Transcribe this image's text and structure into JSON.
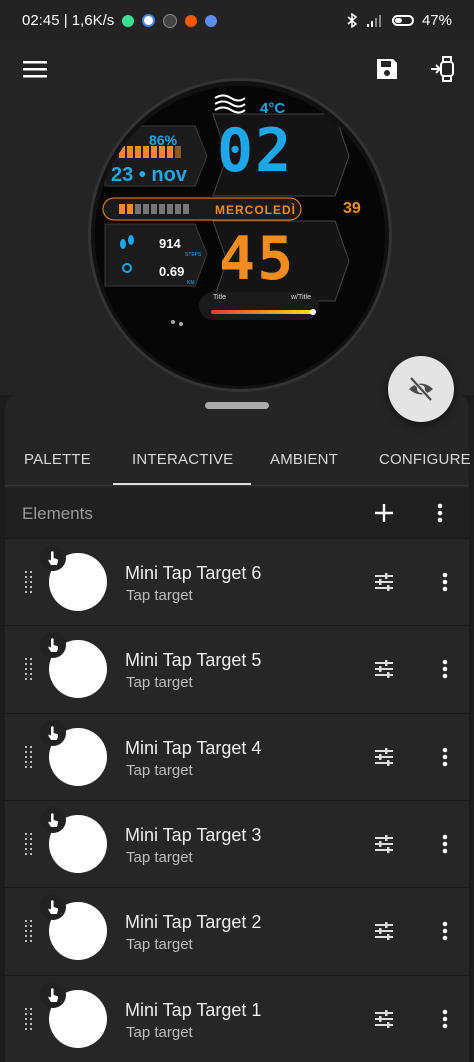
{
  "status_bar": {
    "time_speed": "02:45 | 1,6K/s",
    "battery": "47%",
    "notification_icons": [
      "app-icon",
      "google-icon",
      "app-icon",
      "reddit-icon",
      "app-icon"
    ],
    "system_icons": [
      "bluetooth-icon",
      "wifi-icon",
      "signal-icon",
      "battery-icon"
    ]
  },
  "toolbar": {
    "menu_icon": "hamburger-menu-icon",
    "save_icon": "save-icon",
    "send_to_watch_icon": "watch-sync-icon"
  },
  "watch_face": {
    "weather_icon": "wind-icon",
    "temperature": "4°C",
    "battery_percent": "86%",
    "hours": "02",
    "minutes": "45",
    "date": "23 • nov",
    "weekday": "MERCOLEDÌ",
    "seconds": "39",
    "steps": "914",
    "steps_label": "STEPS",
    "distance": "0.69",
    "distance_label": "KM",
    "bar_title_left": "Title",
    "bar_title_right": "w/Title",
    "colors": {
      "accent_orange": "#f28c1e",
      "accent_blue": "#1ea7e8"
    }
  },
  "visibility_fab_icon": "eye-off-icon",
  "tabs": [
    {
      "label": "PALETTE",
      "active": false
    },
    {
      "label": "INTERACTIVE",
      "active": true
    },
    {
      "label": "AMBIENT",
      "active": false
    },
    {
      "label": "CONFIGURE",
      "active": false
    }
  ],
  "elements": {
    "title": "Elements",
    "add_icon": "plus-icon",
    "more_icon": "more-vert-icon"
  },
  "element_rows": [
    {
      "title": "Mini Tap Target 6",
      "subtitle": "Tap target"
    },
    {
      "title": "Mini Tap Target 5",
      "subtitle": "Tap target"
    },
    {
      "title": "Mini Tap Target 4",
      "subtitle": "Tap target"
    },
    {
      "title": "Mini Tap Target 3",
      "subtitle": "Tap target"
    },
    {
      "title": "Mini Tap Target 2",
      "subtitle": "Tap target"
    },
    {
      "title": "Mini Tap Target 1",
      "subtitle": "Tap target"
    }
  ]
}
